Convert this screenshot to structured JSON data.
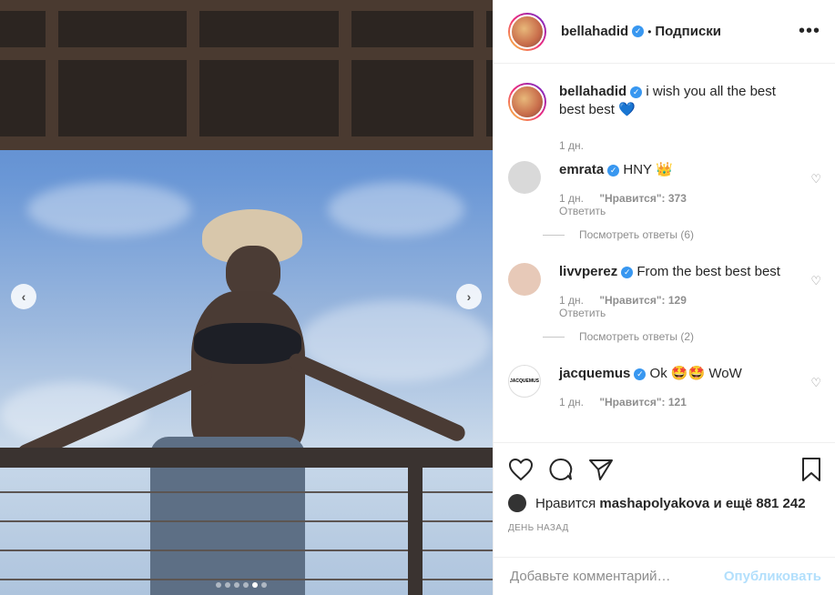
{
  "post": {
    "author": "bellahadid",
    "follow_status": "Подписки",
    "separator": "•",
    "more_icon": "more-horizontal-icon",
    "carousel": {
      "total": 6,
      "active": 5
    }
  },
  "caption": {
    "username": "bellahadid",
    "text": "i wish you all the best best best 💙",
    "time": "1 дн."
  },
  "comments": [
    {
      "username": "emrata",
      "text": "HNY 👑",
      "time": "1 дн.",
      "likes": "\"Нравится\": 373",
      "reply": "Ответить",
      "view_replies": "Посмотреть ответы (6)",
      "avatar_color": "#d8d8d8"
    },
    {
      "username": "livvperez",
      "text": "From the best best best",
      "time": "1 дн.",
      "likes": "\"Нравится\": 129",
      "reply": "Ответить",
      "view_replies": "Посмотреть ответы (2)",
      "avatar_color": "#e7c9b8"
    },
    {
      "username": "jacquemus",
      "text": "Ok 🤩🤩 WoW",
      "time": "1 дн.",
      "likes": "\"Нравится\": 121",
      "avatar_label": "JACQUEMUS"
    }
  ],
  "actions": {
    "liked_prefix": "Нравится",
    "liked_by": "mashapolyakova",
    "liked_suffix": "и ещё 881 242",
    "date": "ДЕНЬ НАЗАД"
  },
  "comment_box": {
    "placeholder": "Добавьте комментарий…",
    "publish": "Опубликовать"
  },
  "colors": {
    "verified": "#3897f0",
    "publish_disabled": "#b2dffc",
    "meta": "#8e8e8e"
  }
}
